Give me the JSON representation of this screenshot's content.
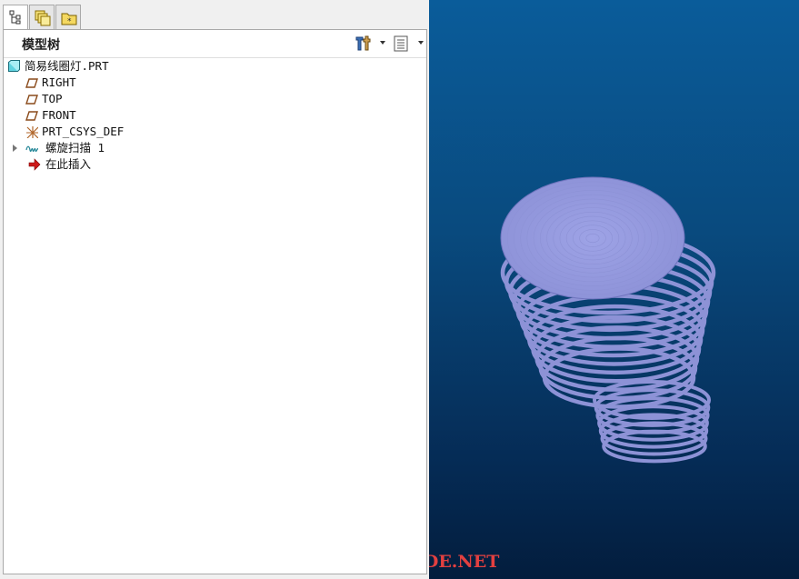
{
  "left_panel": {
    "tabs": [
      {
        "icon": "model-tree-icon"
      },
      {
        "icon": "layers-icon"
      },
      {
        "icon": "favorites-folder-icon"
      }
    ],
    "title": "模型树",
    "tree": [
      {
        "label": "简易线圈灯.PRT",
        "icon": "part-icon"
      },
      {
        "label": "RIGHT",
        "icon": "datum-plane-icon"
      },
      {
        "label": "TOP",
        "icon": "datum-plane-icon"
      },
      {
        "label": "FRONT",
        "icon": "datum-plane-icon"
      },
      {
        "label": "PRT_CSYS_DEF",
        "icon": "coordinate-system-icon"
      },
      {
        "label": "螺旋扫描 1",
        "icon": "helical-sweep-icon"
      },
      {
        "label": "在此插入",
        "icon": "insert-here-arrow-icon"
      }
    ]
  },
  "viewport": {
    "watermark": "BBS.CHINADE.NET",
    "model_color": "#8d92d6"
  }
}
